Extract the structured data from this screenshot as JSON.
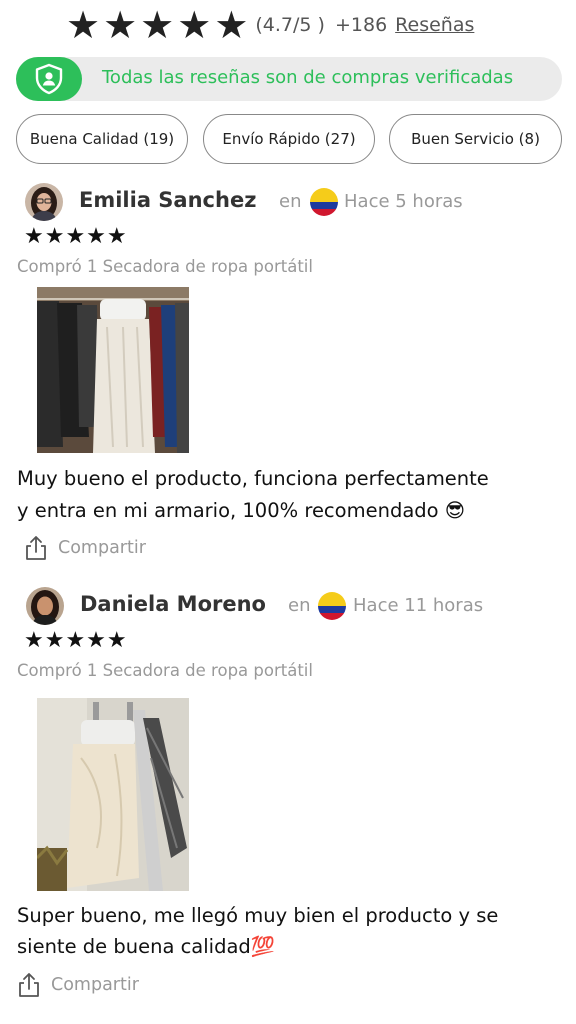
{
  "rating": {
    "stars": [
      "★",
      "★",
      "★",
      "★",
      "★"
    ],
    "score_text": "(4.7/5 )",
    "count_text": "+186",
    "reviews_link": "Reseñas"
  },
  "verified": {
    "text": "Todas las reseñas son de compras verificadas",
    "icon": "shield-user-icon",
    "color": "#2dbf5a"
  },
  "chips": [
    {
      "label": "Buena Calidad (19)"
    },
    {
      "label": "Envío Rápido (27)"
    },
    {
      "label": "Buen Servicio (8)"
    }
  ],
  "reviews": [
    {
      "name": "Emilia Sanchez",
      "en": "en",
      "country_flag": "colombia-flag-icon",
      "time": "Hace 5 horas",
      "stars": "★★★★★",
      "purchase": "Compró 1 Secadora de ropa portátil",
      "text_line1": "Muy bueno el producto, funciona perfectamente",
      "text_line2": "y entra en mi armario, 100% recomendado 😎",
      "share": "Compartir"
    },
    {
      "name": "Daniela Moreno",
      "en": "en",
      "country_flag": "colombia-flag-icon",
      "time": "Hace 11 horas",
      "stars": "★★★★★",
      "purchase": "Compró 1 Secadora de ropa portátil",
      "text_line1": "Super bueno, me llegó muy bien el producto y se",
      "text_line2": "siente de buena calidad💯",
      "share": "Compartir"
    }
  ]
}
